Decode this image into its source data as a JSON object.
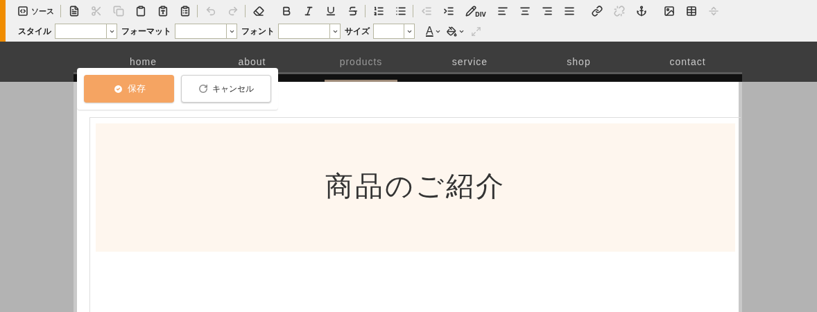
{
  "toolbar": {
    "groups": [
      {
        "divider_after": true,
        "items": [
          {
            "kind": "source",
            "label": "ソース",
            "disabled": false
          }
        ]
      },
      {
        "divider_after": true,
        "items": [
          {
            "kind": "document",
            "disabled": false
          },
          {
            "kind": "cut",
            "disabled": true
          },
          {
            "kind": "copy",
            "disabled": true
          },
          {
            "kind": "paste",
            "disabled": false
          },
          {
            "kind": "paste-text",
            "disabled": false
          },
          {
            "kind": "paste-word",
            "disabled": false
          }
        ]
      },
      {
        "divider_after": true,
        "items": [
          {
            "kind": "undo",
            "disabled": true
          },
          {
            "kind": "redo",
            "disabled": true
          }
        ]
      },
      {
        "divider_after": false,
        "items": [
          {
            "kind": "eraser",
            "disabled": false
          }
        ]
      },
      {
        "divider_after": true,
        "items": [
          {
            "kind": "bold",
            "disabled": false
          },
          {
            "kind": "italic",
            "disabled": false
          },
          {
            "kind": "underline",
            "disabled": false
          },
          {
            "kind": "strike",
            "disabled": false
          }
        ]
      },
      {
        "divider_after": true,
        "items": [
          {
            "kind": "ordered-list",
            "disabled": false
          },
          {
            "kind": "bullet-list",
            "disabled": false
          }
        ]
      },
      {
        "divider_after": false,
        "items": [
          {
            "kind": "outdent",
            "disabled": true
          },
          {
            "kind": "indent",
            "disabled": false
          },
          {
            "kind": "div",
            "label": "DIV",
            "disabled": false
          },
          {
            "kind": "align-left",
            "disabled": false
          },
          {
            "kind": "align-center",
            "disabled": false
          },
          {
            "kind": "align-right",
            "disabled": false
          },
          {
            "kind": "justify",
            "disabled": false
          }
        ]
      },
      {
        "divider_after": false,
        "items": [
          {
            "kind": "link",
            "disabled": false
          },
          {
            "kind": "unlink",
            "disabled": true
          },
          {
            "kind": "anchor",
            "disabled": false
          }
        ]
      },
      {
        "divider_after": false,
        "items": [
          {
            "kind": "image",
            "disabled": false
          },
          {
            "kind": "table",
            "disabled": false
          },
          {
            "kind": "page-break",
            "disabled": true
          }
        ]
      }
    ],
    "combos": [
      {
        "label": "スタイル"
      },
      {
        "label": "フォーマット"
      },
      {
        "label": "フォント"
      },
      {
        "label": "サイズ"
      }
    ],
    "color_buttons": [
      {
        "kind": "text-color",
        "label": "A"
      },
      {
        "kind": "background-color"
      }
    ],
    "maximize": {
      "disabled": true
    }
  },
  "nav": [
    {
      "label": "home",
      "selected": false
    },
    {
      "label": "about",
      "selected": false
    },
    {
      "label": "products",
      "selected": true
    },
    {
      "label": "service",
      "selected": false
    },
    {
      "label": "shop",
      "selected": false
    },
    {
      "label": "contact",
      "selected": false
    }
  ],
  "edit_panel": {
    "save": "保存",
    "cancel": "キャンセル"
  },
  "hero": {
    "heading": "商品のご紹介"
  }
}
